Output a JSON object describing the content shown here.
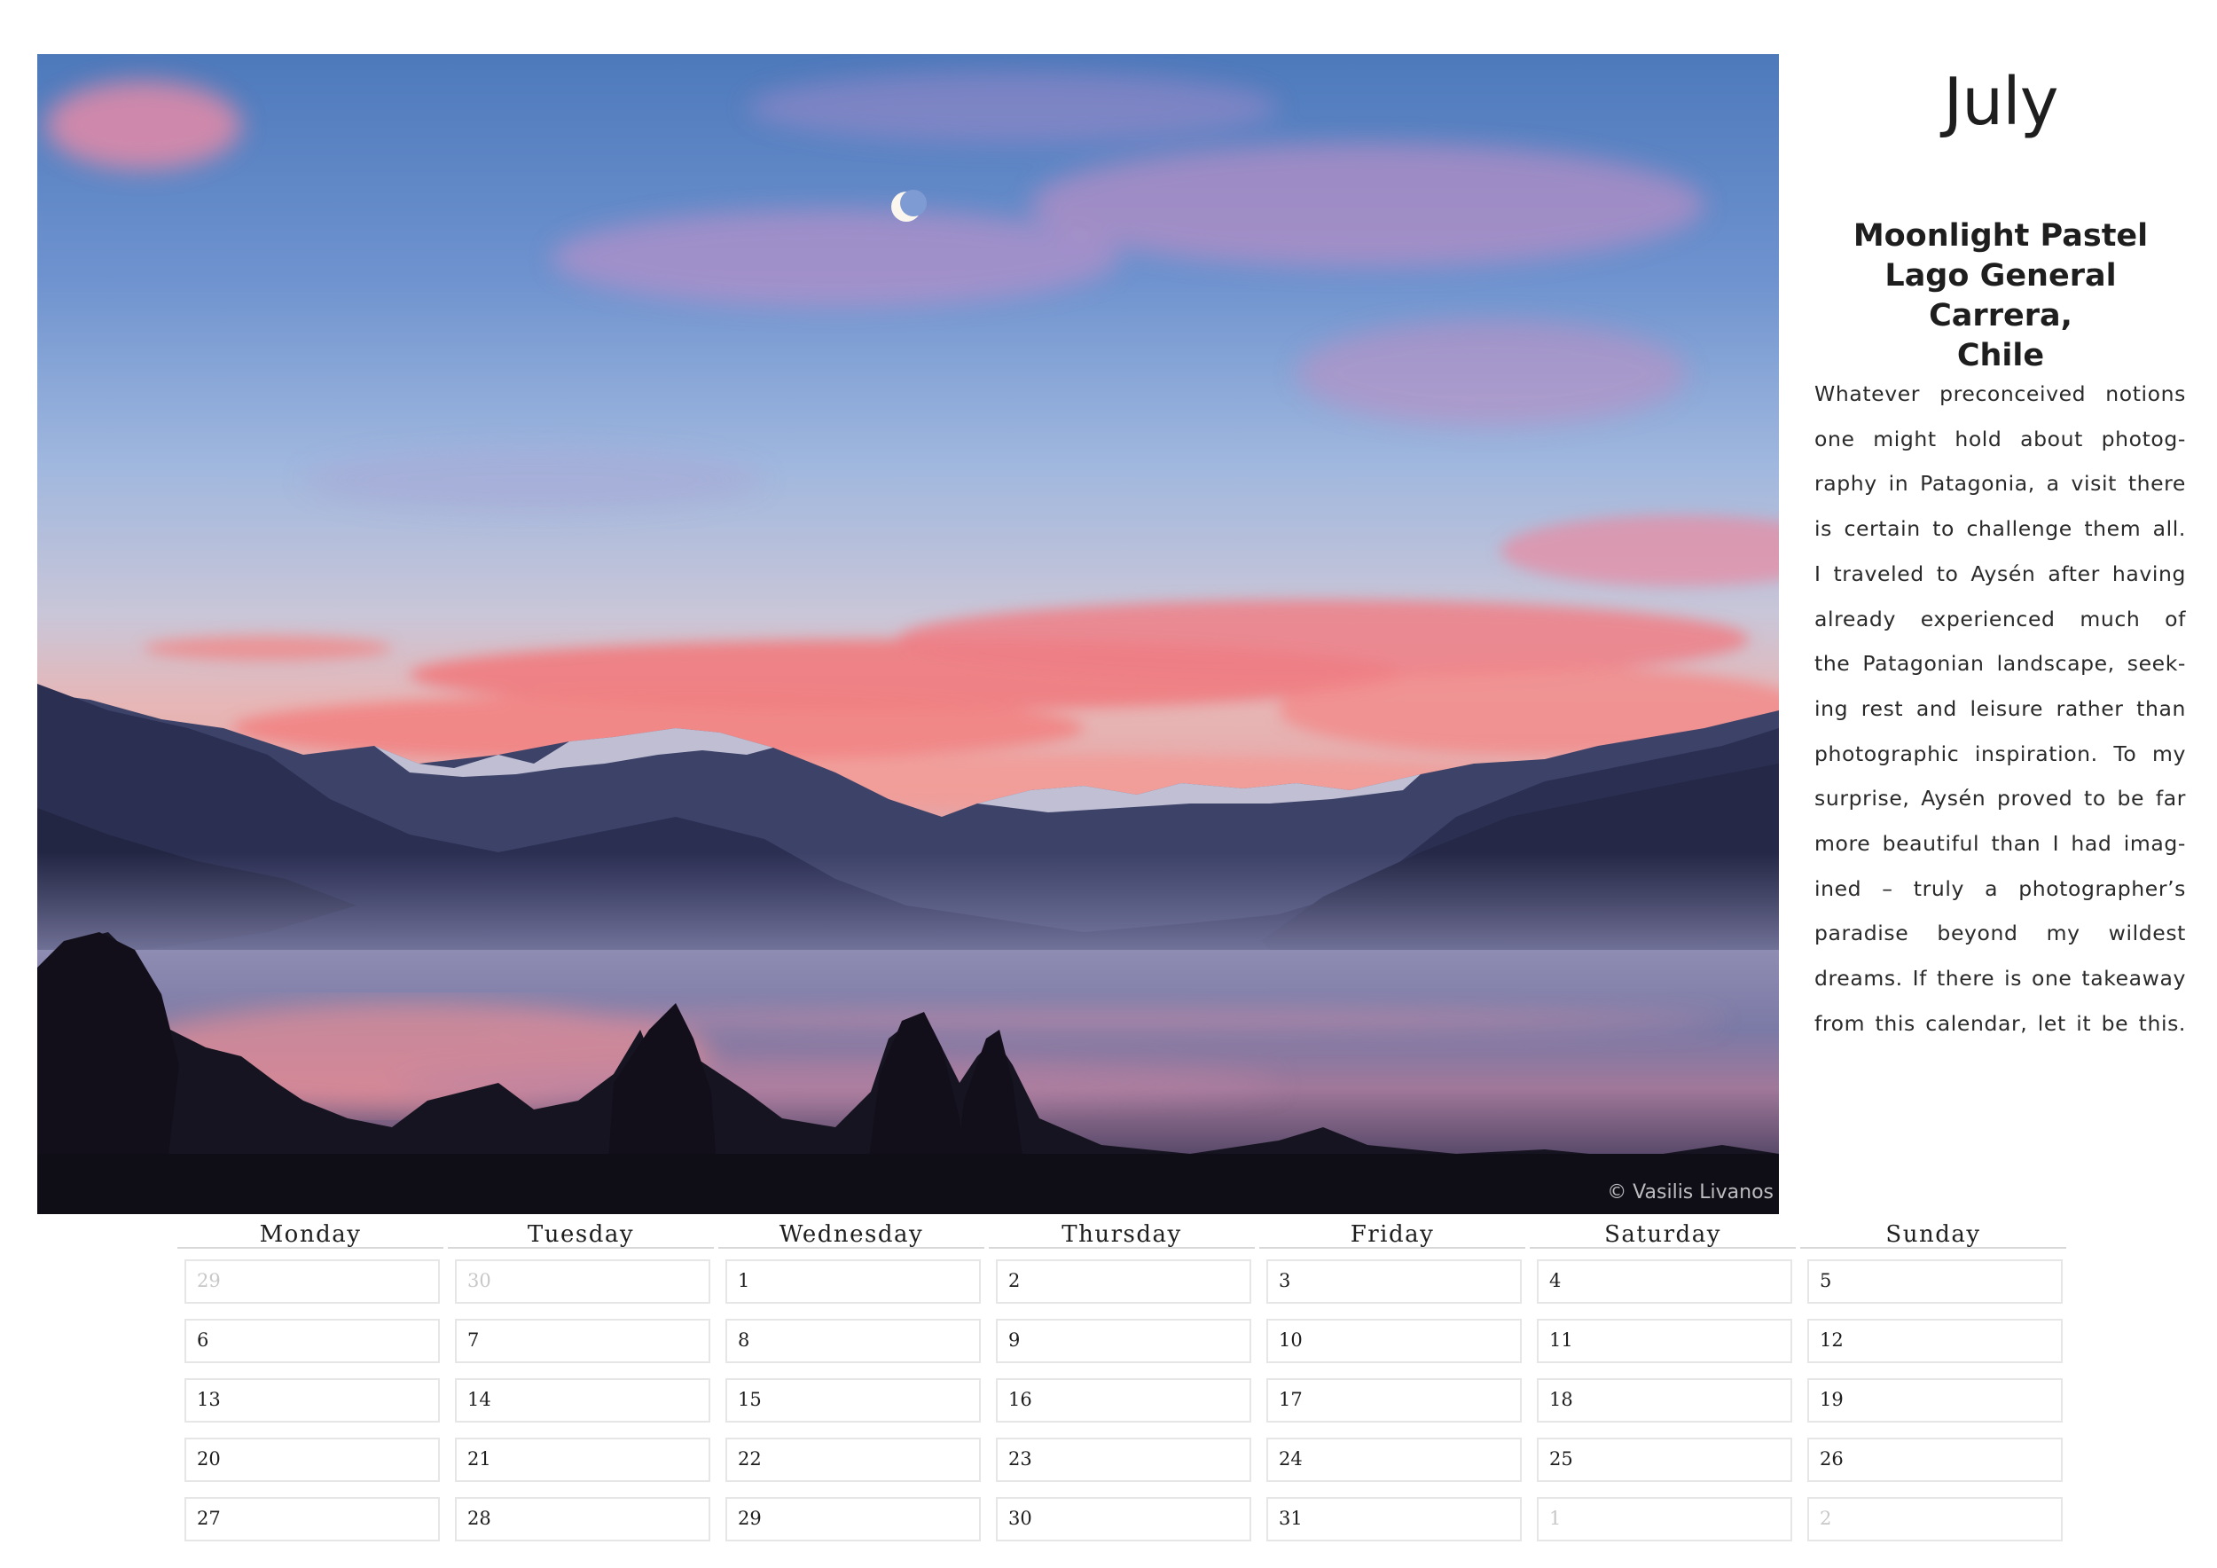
{
  "month": "July",
  "photo": {
    "title_lines": [
      "Moonlight Pastel",
      "Lago General Carrera,",
      "Chile"
    ],
    "credit": "© Vasilis Livanos",
    "description_lines": [
      "Whatever preconceived notions",
      "one might hold about photog-",
      "raphy in Patagonia, a visit there",
      "is certain to challenge them all.",
      "I traveled to Aysén after having",
      "already experienced much of",
      "the Patagonian landscape, seek-",
      "ing rest and leisure rather than",
      "photographic inspiration. To my",
      "surprise, Aysén proved to be far",
      "more beautiful than I had imag-",
      "ined – truly a photographer’s",
      "paradise beyond my wildest",
      "dreams. If there is one takeaway",
      "from this calendar, let it be this."
    ]
  },
  "calendar": {
    "weekdays": [
      "Monday",
      "Tuesday",
      "Wednesday",
      "Thursday",
      "Friday",
      "Saturday",
      "Sunday"
    ],
    "weeks": [
      [
        {
          "d": "29",
          "muted": true
        },
        {
          "d": "30",
          "muted": true
        },
        {
          "d": "1"
        },
        {
          "d": "2"
        },
        {
          "d": "3"
        },
        {
          "d": "4"
        },
        {
          "d": "5"
        }
      ],
      [
        {
          "d": "6"
        },
        {
          "d": "7"
        },
        {
          "d": "8"
        },
        {
          "d": "9"
        },
        {
          "d": "10"
        },
        {
          "d": "11"
        },
        {
          "d": "12"
        }
      ],
      [
        {
          "d": "13"
        },
        {
          "d": "14"
        },
        {
          "d": "15"
        },
        {
          "d": "16"
        },
        {
          "d": "17"
        },
        {
          "d": "18"
        },
        {
          "d": "19"
        }
      ],
      [
        {
          "d": "20"
        },
        {
          "d": "21"
        },
        {
          "d": "22"
        },
        {
          "d": "23"
        },
        {
          "d": "24"
        },
        {
          "d": "25"
        },
        {
          "d": "26"
        }
      ],
      [
        {
          "d": "27"
        },
        {
          "d": "28"
        },
        {
          "d": "29"
        },
        {
          "d": "30"
        },
        {
          "d": "31"
        },
        {
          "d": "1",
          "muted": true
        },
        {
          "d": "2",
          "muted": true
        }
      ]
    ]
  }
}
